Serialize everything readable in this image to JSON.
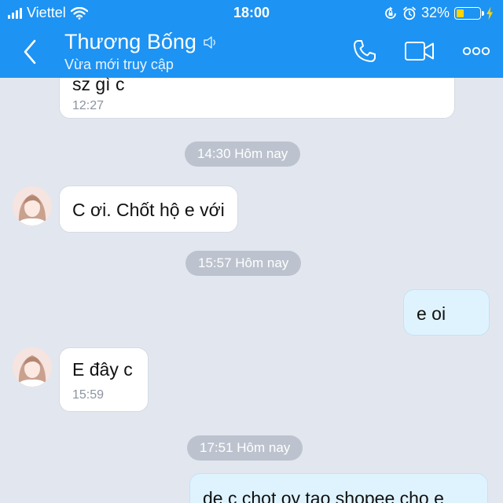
{
  "status_bar": {
    "carrier": "Viettel",
    "time": "18:00",
    "battery_text": "32%",
    "battery_level": 0.32
  },
  "header": {
    "contact_name": "Thương Bống",
    "contact_status": "Vừa mới truy cập"
  },
  "messages": [
    {
      "type": "incoming",
      "text": "sz gì c",
      "time": "12:27"
    },
    {
      "type": "divider",
      "text": "14:30 Hôm nay"
    },
    {
      "type": "incoming",
      "text": "C ơi. Chốt hộ e với",
      "time": ""
    },
    {
      "type": "divider",
      "text": "15:57 Hôm nay"
    },
    {
      "type": "outgoing",
      "text": "e oi",
      "time": ""
    },
    {
      "type": "incoming",
      "text": "E đây c",
      "time": "15:59"
    },
    {
      "type": "divider",
      "text": "17:51 Hôm nay"
    },
    {
      "type": "outgoing",
      "text": "de c chot ọy tao shopee cho e",
      "time": ""
    }
  ],
  "colors": {
    "header_bg": "#1d93f3",
    "chat_bg": "#e2e7ef",
    "outgoing_bubble": "#dff3fe",
    "incoming_bubble": "#ffffff",
    "battery_fill": "#ffd400"
  }
}
